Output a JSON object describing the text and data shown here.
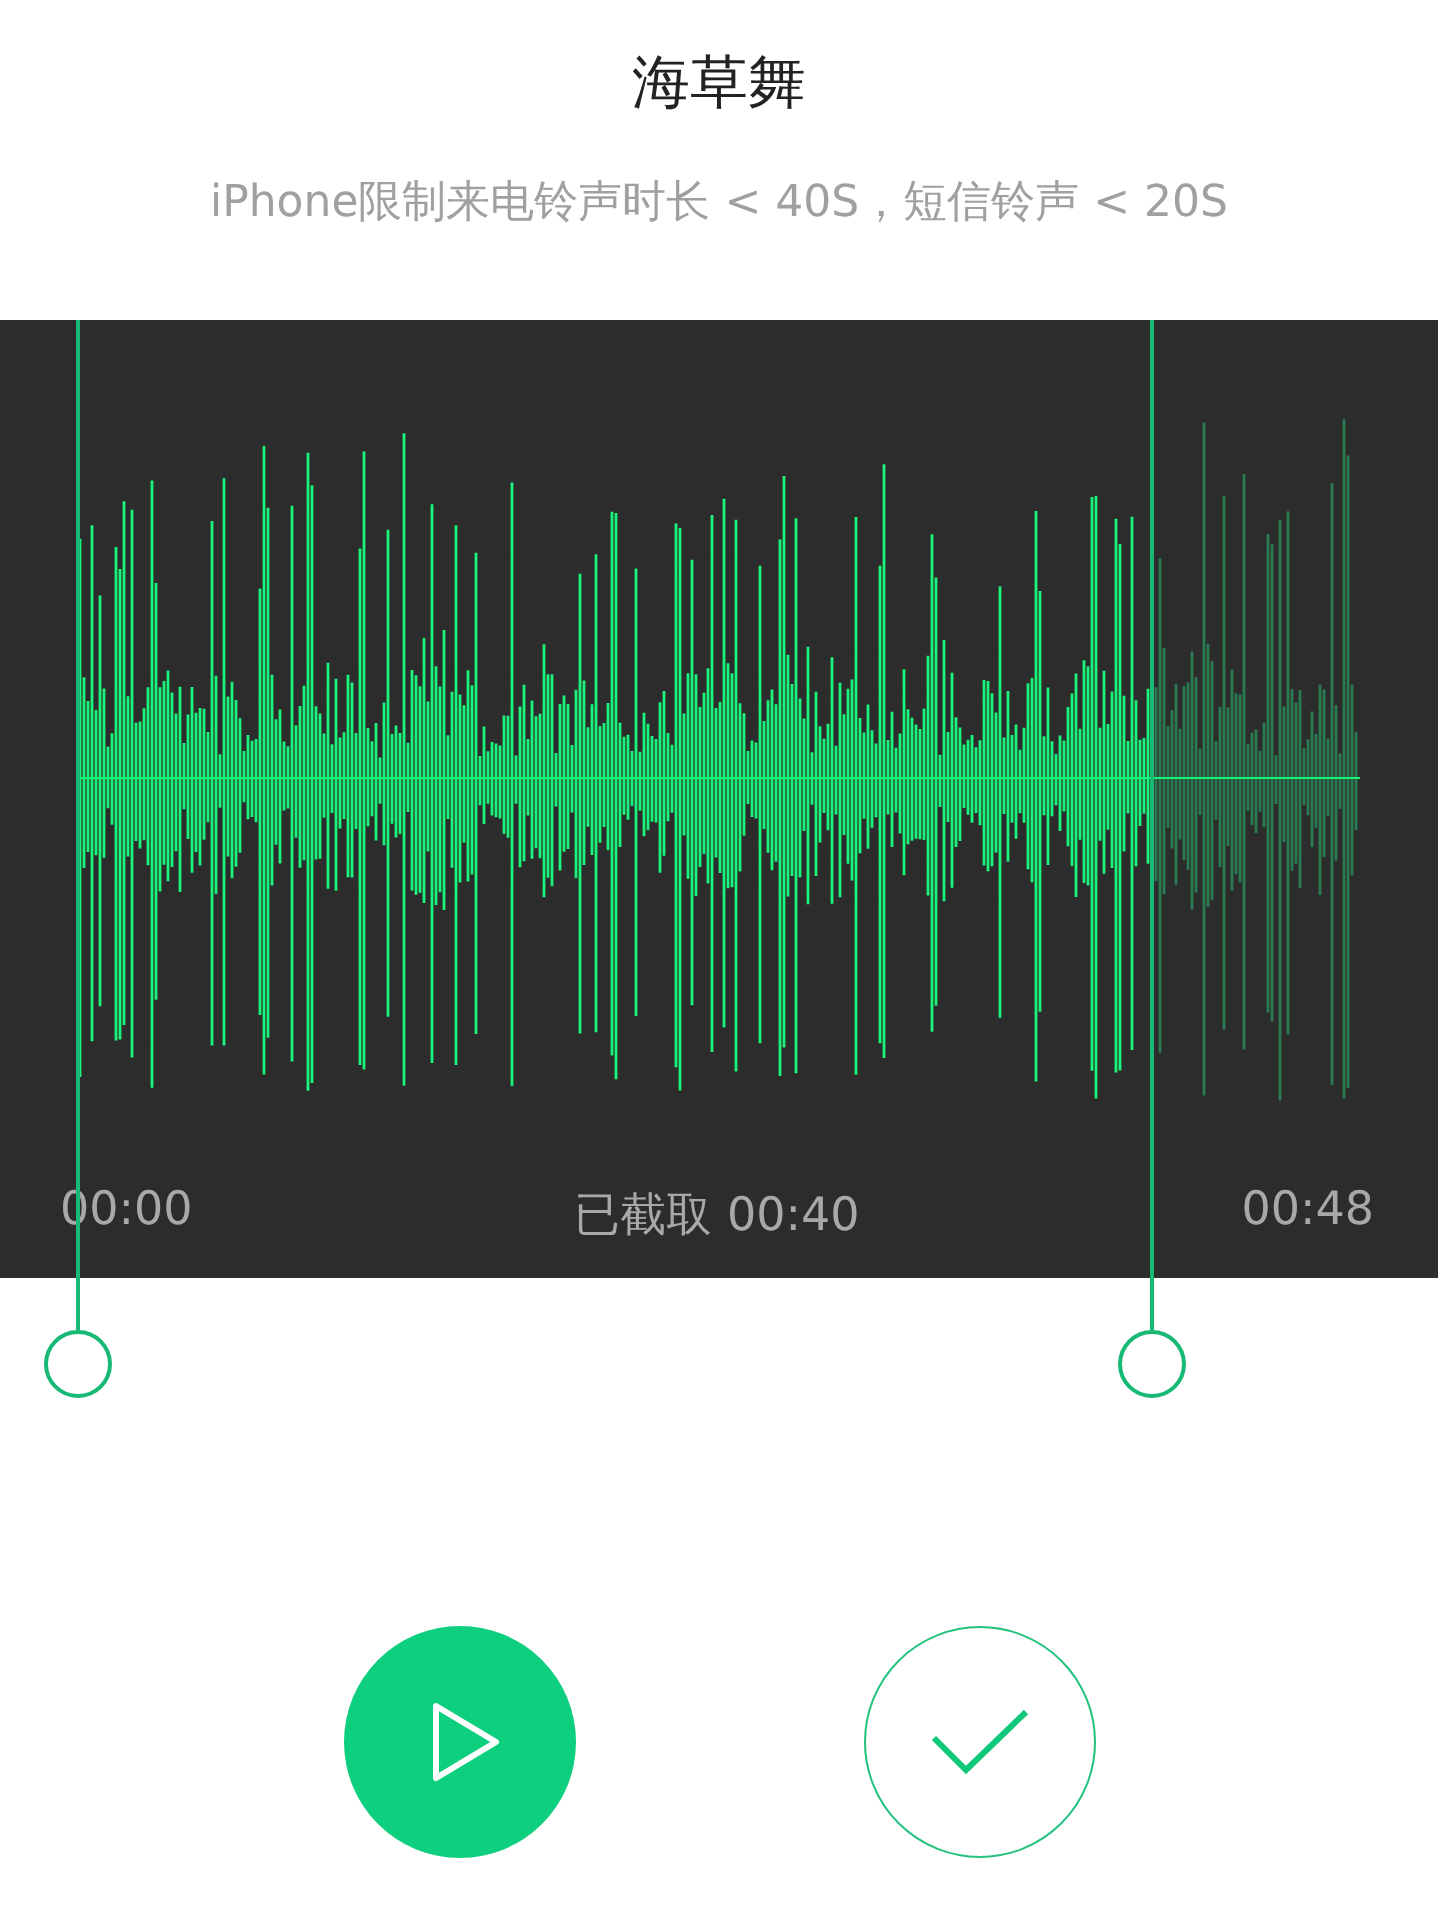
{
  "title": "海草舞",
  "subtitle": "iPhone限制来电铃声时长 < 40S，短信铃声 < 20S",
  "timeline": {
    "start": "00:00",
    "selected": "已截取 00:40",
    "end": "00:48"
  }
}
